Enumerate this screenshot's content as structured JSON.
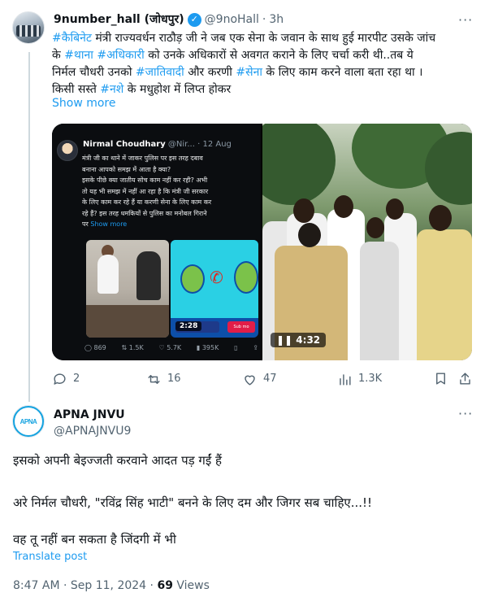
{
  "quoted_tweet": {
    "author_name": "9number_hall (जोधपुर)",
    "handle": "@9noHall",
    "separator": "·",
    "time": "3h",
    "text_lines": [
      [
        {
          "t": "#कैबिनेट",
          "tag": true
        },
        {
          "t": " मंत्री राज्यवर्धन राठौड़ जी ने जब एक सेना के जवान के साथ हुई मारपीट उसके जांच"
        }
      ],
      [
        {
          "t": "के "
        },
        {
          "t": "#थाना",
          "tag": true
        },
        {
          "t": " "
        },
        {
          "t": "#अधिकारी",
          "tag": true
        },
        {
          "t": " को उनके अधिकारों से अवगत कराने के लिए चर्चा करी थी..तब ये"
        }
      ],
      [
        {
          "t": "निर्मल चौधरी उनको "
        },
        {
          "t": "#जातिवादी",
          "tag": true
        },
        {
          "t": " और करणी "
        },
        {
          "t": "#सेना",
          "tag": true
        },
        {
          "t": " के लिए काम करने वाला बता रहा था ।"
        }
      ],
      [
        {
          "t": "किसी सस्ते "
        },
        {
          "t": "#नशे",
          "tag": true
        },
        {
          "t": " के मधुहोश में लिप्त होकर"
        }
      ]
    ],
    "show_more": "Show more",
    "media": {
      "embedded_tweet": {
        "author": "Nirmal Choudhary",
        "handle": "@Nir...",
        "date": "· 12 Aug",
        "text_lines": [
          "मंत्री जी का थाने में जाकर पुलिस पर इस तरह दबाव",
          "बनाना आपको समझ में आता है क्या?",
          "इसके पीछे क्या जातीय सोच काम नहीं कर रही? अभी",
          "तो यह भी समझ में नहीं आ रहा है कि मंत्री जी सरकार",
          "के लिए काम कर रहे हैं या करणी सेना के लिए काम कर",
          "रहे हैं? इस तरह धमकियों से पुलिस का मनोबल गिराने",
          "पर"
        ],
        "show_more": "Show more",
        "video_duration": "2:28",
        "video_tag": "Sub mo",
        "stats": {
          "replies": "869",
          "reposts": "1.5K",
          "likes": "5.7K",
          "views": "395K"
        }
      },
      "video_duration": "4:32"
    },
    "actions": {
      "replies": "2",
      "reposts": "16",
      "likes": "47",
      "views": "1.3K"
    }
  },
  "main_tweet": {
    "author_name": "APNA JNVU",
    "handle": "@APNAJNVU9",
    "avatar_text": "APNA",
    "lines": [
      "इसको अपनी बेइज्जती करवाने आदत पड़ गईं हैं",
      "अरे निर्मल चौधरी, \"रविंद्र सिंह भाटी\" बनने के लिए दम और जिगर सब चाहिए...!!",
      "वह तू नहीं बन सकता है जिंदगी में भी"
    ],
    "translate": "Translate post",
    "time": "8:47 AM",
    "date": "Sep 11, 2024",
    "views_count": "69",
    "views_label": "Views"
  },
  "colors": {
    "accent": "#1d9bf0",
    "muted": "#536471",
    "text": "#0f1419"
  }
}
